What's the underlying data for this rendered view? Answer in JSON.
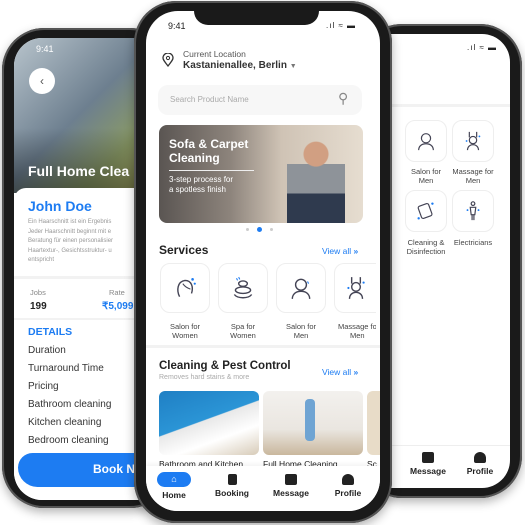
{
  "status_time": "9:41",
  "left": {
    "title": "Full Home Clea",
    "name": "John Doe",
    "description": [
      "Ein Haarschnitt ist ein Ergebnis",
      "Jeder Haarschnitt beginnt mit e",
      "Beratung für einen personalisier",
      "Haartextur-, Gesichtsstruktur- u",
      "entspricht"
    ],
    "jobs_label": "Jobs",
    "jobs_value": "199",
    "rate_label": "Rate",
    "rate_value": "₹5,099",
    "details_heading": "DETAILS",
    "details": [
      "Duration",
      "Turnaround Time",
      "Pricing",
      "Bathroom cleaning",
      "Kitchen cleaning",
      "Bedroom cleaning"
    ],
    "book_label": "Book N"
  },
  "center": {
    "location_label": "Current Location",
    "location_value": "Kastanienallee, Berlin",
    "search_placeholder": "Search Product Name",
    "banner_title_1": "Sofa & Carpet",
    "banner_title_2": "Cleaning",
    "banner_sub_1": "3-step process for",
    "banner_sub_2": "a spotless finish",
    "carousel_active": 2,
    "carousel_count": 3,
    "services_title": "Services",
    "view_all": "View all",
    "services": [
      {
        "l1": "Salon for",
        "l2": "Women"
      },
      {
        "l1": "Spa for",
        "l2": "Women"
      },
      {
        "l1": "Salon for",
        "l2": "Men"
      },
      {
        "l1": "Massage for",
        "l2": "Men"
      }
    ],
    "cleaning_title": "Cleaning & Pest Control",
    "cleaning_sub": "Removes hard stains & more",
    "cleaning_items": [
      "Bathroom and Kitchen",
      "Full Home Cleaning",
      "Sc"
    ],
    "nav": [
      "Home",
      "Booking",
      "Message",
      "Profile"
    ]
  },
  "right": {
    "grid": [
      {
        "l1": "Salon for",
        "l2": "Men"
      },
      {
        "l1": "Massage for",
        "l2": "Men"
      },
      {
        "l1": "Cleaning &",
        "l2": "Disinfection"
      },
      {
        "l1": "Electricians",
        "l2": ""
      }
    ],
    "partial_label": "s",
    "nav": [
      "Message",
      "Profile"
    ]
  },
  "colors": {
    "accent": "#1d7cf2",
    "frame": "#1a1a1a"
  }
}
